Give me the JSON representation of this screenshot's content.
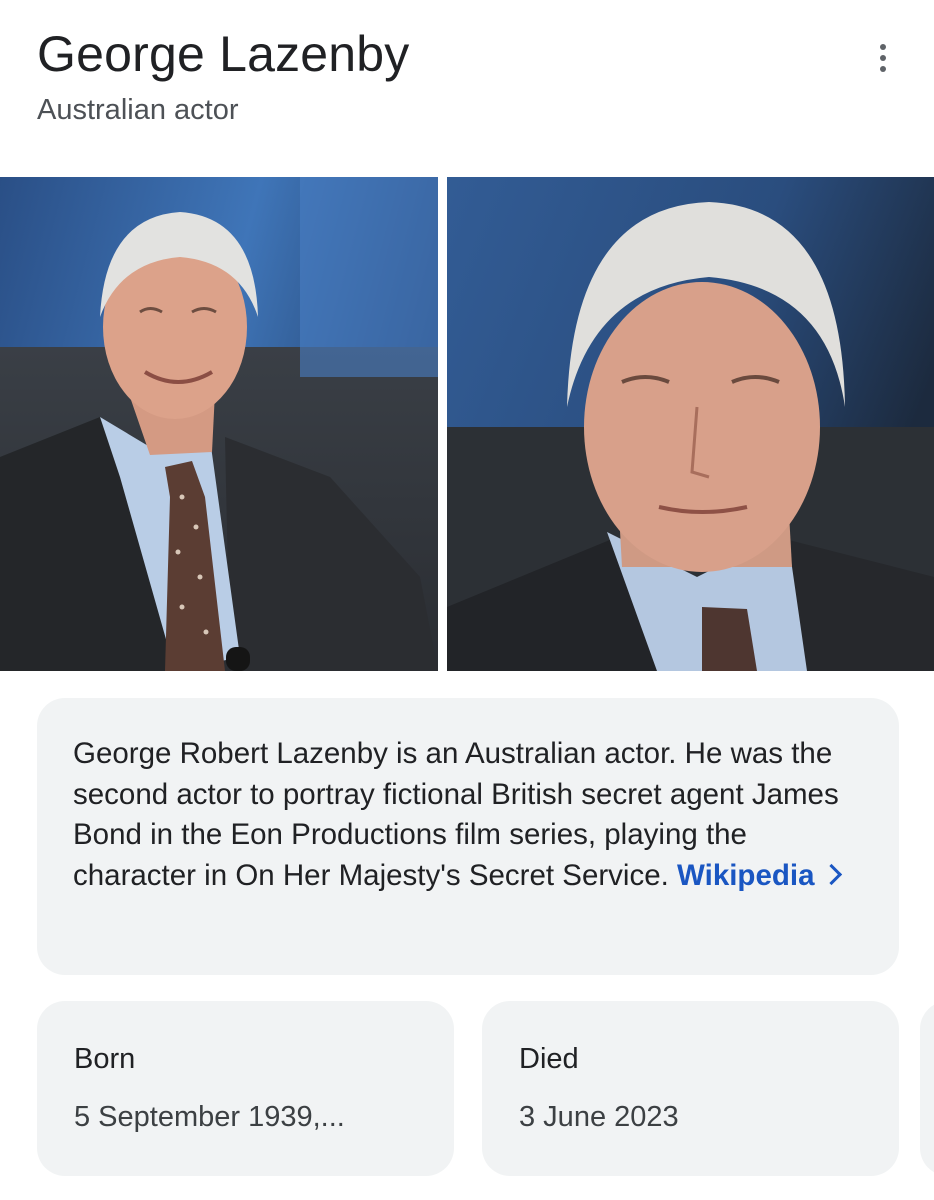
{
  "header": {
    "title": "George Lazenby",
    "subtitle": "Australian actor"
  },
  "icons": {
    "more": "more-vert-icon",
    "chevron": "chevron-right-icon"
  },
  "colors": {
    "link": "#1a56c2",
    "card_background": "#f1f3f4",
    "title_text": "#202124",
    "subtitle_text": "#4d5156"
  },
  "description": {
    "text": "George Robert Lazenby is an Australian actor. He was the second actor to portray fictional British secret agent James Bond in the Eon Productions film series, playing the character in On Her Majesty's Secret Service.",
    "source_label": "Wikipedia"
  },
  "facts": [
    {
      "label": "Born",
      "value": "5 September 1939,..."
    },
    {
      "label": "Died",
      "value": "3 June 2023"
    }
  ]
}
